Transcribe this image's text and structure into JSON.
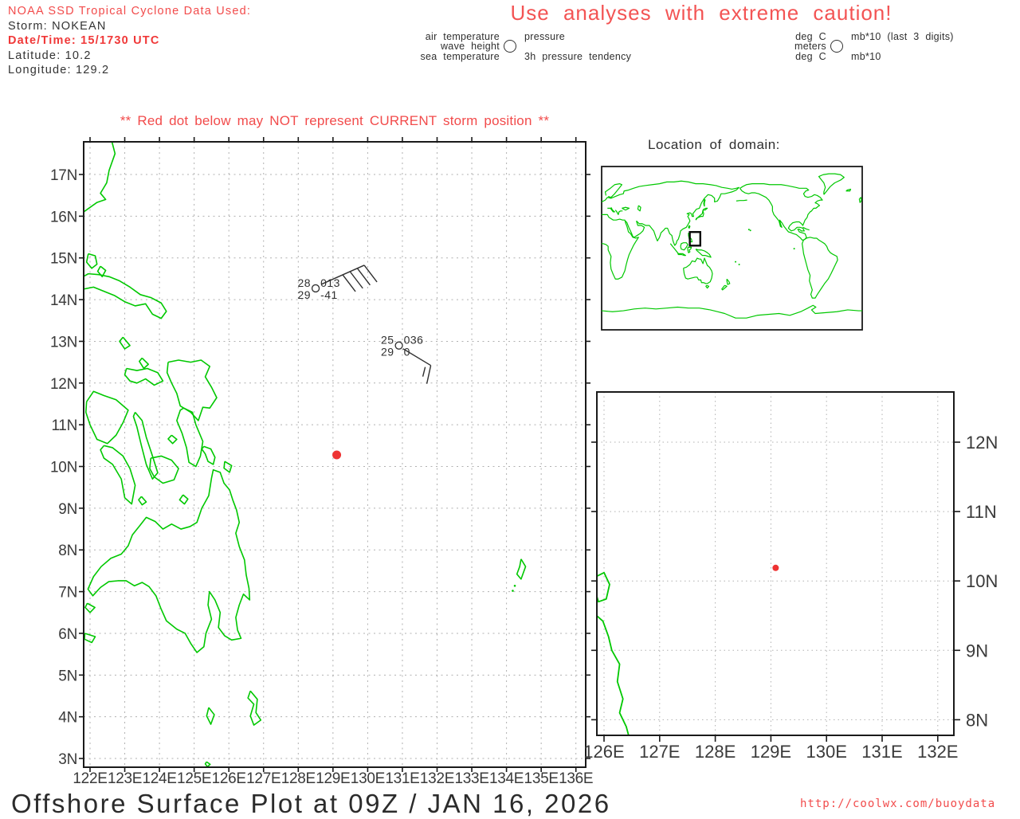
{
  "header": {
    "noaa_line": "NOAA SSD Tropical Cyclone Data Used:",
    "storm": "Storm: NOKEAN",
    "datetime": "Date/Time: 15/1730 UTC",
    "latitude": "Latitude: 10.2",
    "longitude": "Longitude: 129.2"
  },
  "caution": "Use analyses with extreme caution!",
  "station_legend": {
    "labels": {
      "air_temp": "air temperature",
      "wave_height": "wave height",
      "sea_temp": "sea temperature",
      "pressure": "pressure",
      "tendency": "3h pressure tendency"
    },
    "units": {
      "air_temp": "deg C",
      "wave_height": "meters",
      "sea_temp": "deg C",
      "pressure": "mb*10 (last 3 digits)",
      "tendency": "mb*10"
    }
  },
  "storm_warning": "** Red dot below may NOT represent CURRENT storm position **",
  "main_map": {
    "x_tick_labels": [
      "122E",
      "123E",
      "124E",
      "125E",
      "126E",
      "127E",
      "128E",
      "129E",
      "130E",
      "131E",
      "132E",
      "133E",
      "134E",
      "135E",
      "136E"
    ],
    "y_tick_labels": [
      "17N",
      "16N",
      "15N",
      "14N",
      "13N",
      "12N",
      "11N",
      "10N",
      "9N",
      "8N",
      "7N",
      "6N",
      "5N",
      "4N",
      "3N"
    ],
    "stations": [
      {
        "air_temp": "28",
        "pressure": "013",
        "sea_temp": "29",
        "tendency": "-41",
        "lon": 128.5,
        "lat": 14.27
      },
      {
        "air_temp": "25",
        "pressure": "036",
        "sea_temp": "29",
        "tendency": "0",
        "lon": 130.9,
        "lat": 12.9
      }
    ],
    "storm_dot": {
      "lon": 129.2,
      "lat": 10.2
    }
  },
  "domain_map": {
    "title": "Location of domain:"
  },
  "zoom_map": {
    "x_tick_labels": [
      "126E",
      "127E",
      "128E",
      "129E",
      "130E",
      "131E",
      "132E"
    ],
    "y_tick_labels": [
      "12N",
      "11N",
      "10N",
      "9N",
      "8N"
    ],
    "storm_dot": {
      "lon": 129.2,
      "lat": 10.2
    }
  },
  "footer": {
    "title": "Offshore Surface Plot at 09Z / JAN 16, 2026",
    "url": "http://coolwx.com/buoydata"
  },
  "colors": {
    "coast_green": "#00c800",
    "warn_red": "#f24b4b",
    "dot_red": "#ee3333",
    "grid_gray": "#b0b0b0",
    "axis_dark": "#1a1a1a",
    "text_dark": "#2f2f2f"
  }
}
